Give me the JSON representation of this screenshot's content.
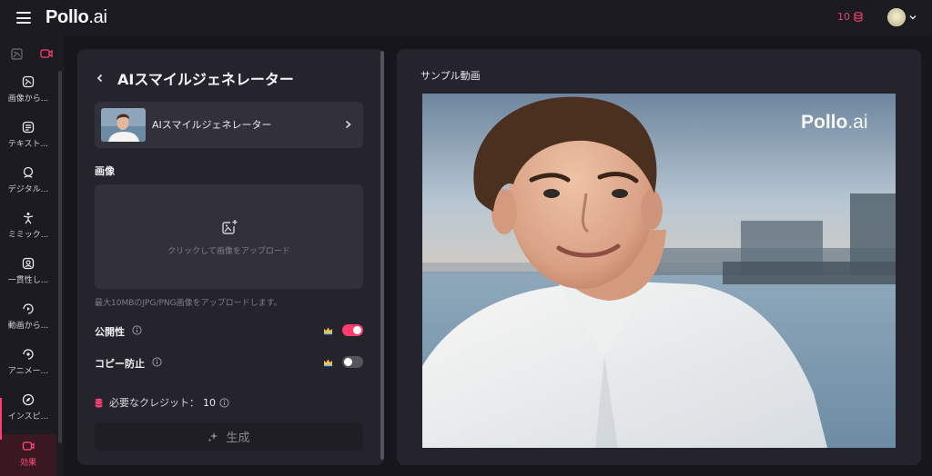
{
  "app": {
    "logo_main": "Pollo",
    "logo_suffix": ".ai",
    "credits": "10",
    "colors": {
      "accent": "#ff3d6e",
      "background": "#17161c",
      "panel": "#25242d",
      "card": "#32313a"
    }
  },
  "sidebar": {
    "tabs": [
      {
        "icon": "image-icon"
      },
      {
        "icon": "video-camera-icon"
      }
    ],
    "items": [
      {
        "label": "画像から...",
        "icon": "image-to-video-icon"
      },
      {
        "label": "テキスト...",
        "icon": "text-to-video-icon"
      },
      {
        "label": "デジタル...",
        "icon": "digital-human-icon"
      },
      {
        "label": "ミミック...",
        "icon": "mimic-dance-icon"
      },
      {
        "label": "一貫性し...",
        "icon": "consistent-character-icon"
      },
      {
        "label": "動画から...",
        "icon": "video-to-video-icon"
      },
      {
        "label": "アニメー...",
        "icon": "animation-icon"
      },
      {
        "label": "インスピ...",
        "icon": "compass-icon"
      },
      {
        "label": "効果",
        "icon": "effects-icon",
        "active": true
      }
    ]
  },
  "left_panel": {
    "title": "AIスマイルジェネレーター",
    "model_card_label": "AIスマイルジェネレーター",
    "image_section_label": "画像",
    "upload_text": "クリックして画像をアップロード",
    "upload_hint": "最大10MBのJPG/PNG画像をアップロードします。",
    "options": [
      {
        "label": "公開性",
        "enabled": true
      },
      {
        "label": "コピー防止",
        "enabled": false
      }
    ],
    "credits_label": "必要なクレジット：",
    "credits_value": "10",
    "generate_label": "生成"
  },
  "right_panel": {
    "sample_label": "サンプル動画",
    "watermark_main": "Pollo",
    "watermark_suffix": ".ai"
  }
}
